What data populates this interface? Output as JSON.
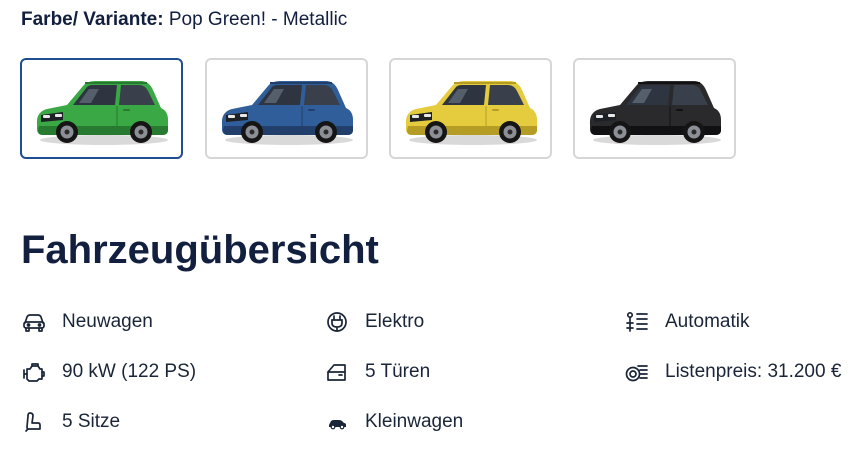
{
  "variant": {
    "label": "Farbe/ Variante:",
    "value": "Pop Green! - Metallic"
  },
  "swatches": [
    {
      "name": "green",
      "color": "#3aa845",
      "dark": "#287a31",
      "selected": true
    },
    {
      "name": "blue",
      "color": "#2f5e9a",
      "dark": "#213f6a",
      "selected": false
    },
    {
      "name": "yellow",
      "color": "#e5cc3e",
      "dark": "#b59d25",
      "selected": false
    },
    {
      "name": "black",
      "color": "#2a2a2c",
      "dark": "#111113",
      "selected": false
    }
  ],
  "overview": {
    "title": "Fahrzeugübersicht",
    "features": {
      "condition": "Neuwagen",
      "fuel": "Elektro",
      "transmission": "Automatik",
      "power": "90 kW (122 PS)",
      "doors": "5 Türen",
      "price": "Listenpreis: 31.200 €",
      "seats": "5 Sitze",
      "body_type": "Kleinwagen"
    }
  },
  "icons": {
    "condition": "car-front-icon",
    "fuel": "electric-plug-icon",
    "transmission": "gear-shift-icon",
    "power": "engine-icon",
    "doors": "car-door-icon",
    "price": "price-coins-icon",
    "seats": "car-seat-icon",
    "body_type": "small-car-icon"
  },
  "colors": {
    "text_primary": "#121f3e",
    "selected_border": "#1f4e8f",
    "border": "#d6d6d6"
  }
}
